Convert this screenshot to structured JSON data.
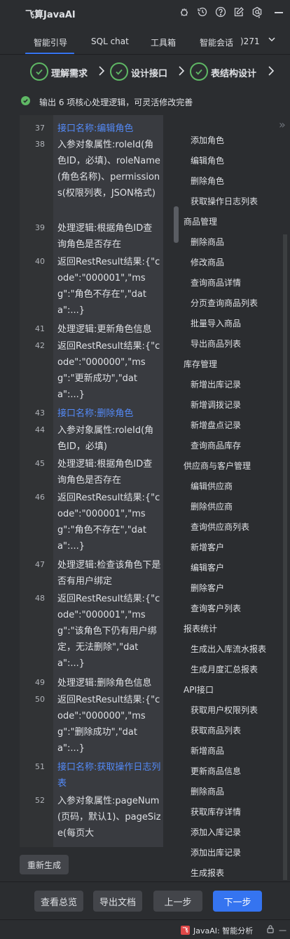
{
  "app": {
    "title": "飞算JavaAI"
  },
  "titlebar_icons": [
    "bug-icon",
    "history-icon",
    "help-icon",
    "edit-icon",
    "settings-icon"
  ],
  "tabs": [
    {
      "label": "智能引导",
      "active": true
    },
    {
      "label": "SQL chat"
    },
    {
      "label": "工具箱"
    },
    {
      "label": "智能会话"
    },
    {
      "label": ")271"
    }
  ],
  "steps": [
    {
      "label": "理解需求"
    },
    {
      "label": "设计接口"
    },
    {
      "label": "表结构设计"
    }
  ],
  "status": {
    "text": "输出 6 项核心处理逻辑，可灵活修改完善",
    "color": "#5fb865"
  },
  "editor_lines": [
    {
      "num": "37",
      "text": "接口名称:编辑角色",
      "link": true
    },
    {
      "num": "38",
      "text": "入参对象属性:roleId(角色ID，必填)、roleName(角色名称)、permissions(权限列表，JSON格式)"
    },
    {
      "num": "39",
      "text": "处理逻辑:根据角色ID查询角色是否存在"
    },
    {
      "num": "40",
      "text": "返回RestResult结果:{\"code\":\"000001\",\"msg\":\"角色不存在\",\"data\":...}"
    },
    {
      "num": "41",
      "text": "处理逻辑:更新角色信息"
    },
    {
      "num": "42",
      "text": "返回RestResult结果:{\"code\":\"000000\",\"msg\":\"更新成功\",\"data\":...}"
    },
    {
      "num": "43",
      "text": "接口名称:删除角色",
      "link": true
    },
    {
      "num": "44",
      "text": "入参对象属性:roleId(角色ID，必填)"
    },
    {
      "num": "45",
      "text": "处理逻辑:根据角色ID查询角色是否存在"
    },
    {
      "num": "46",
      "text": "返回RestResult结果:{\"code\":\"000001\",\"msg\":\"角色不存在\",\"data\":...}"
    },
    {
      "num": "47",
      "text": "处理逻辑:检查该角色下是否有用户绑定"
    },
    {
      "num": "48",
      "text": "返回RestResult结果:{\"code\":\"000001\",\"msg\":\"该角色下仍有用户绑定，无法删除\",\"data\":...}"
    },
    {
      "num": "49",
      "text": "处理逻辑:删除角色信息"
    },
    {
      "num": "50",
      "text": "返回RestResult结果:{\"code\":\"000000\",\"msg\":\"删除成功\",\"data\":...}"
    },
    {
      "num": "51",
      "text": "接口名称:获取操作日志列表",
      "link": true
    },
    {
      "num": "52",
      "text": "入参对象属性:pageNum(页码，默认1)、pageSize(每页大"
    }
  ],
  "tree": [
    {
      "label": "添加角色",
      "level": 1
    },
    {
      "label": "编辑角色",
      "level": 1
    },
    {
      "label": "删除角色",
      "level": 1
    },
    {
      "label": "获取操作日志列表",
      "level": 1
    },
    {
      "label": "商品管理",
      "level": 0
    },
    {
      "label": "删除商品",
      "level": 1
    },
    {
      "label": "修改商品",
      "level": 1
    },
    {
      "label": "查询商品详情",
      "level": 1
    },
    {
      "label": "分页查询商品列表",
      "level": 1
    },
    {
      "label": "批量导入商品",
      "level": 1
    },
    {
      "label": "导出商品列表",
      "level": 1
    },
    {
      "label": "库存管理",
      "level": 0
    },
    {
      "label": "新增出库记录",
      "level": 1
    },
    {
      "label": "新增调拨记录",
      "level": 1
    },
    {
      "label": "新增盘点记录",
      "level": 1
    },
    {
      "label": "查询商品库存",
      "level": 1
    },
    {
      "label": "供应商与客户管理",
      "level": 0
    },
    {
      "label": "编辑供应商",
      "level": 1
    },
    {
      "label": "删除供应商",
      "level": 1
    },
    {
      "label": "查询供应商列表",
      "level": 1
    },
    {
      "label": "新增客户",
      "level": 1
    },
    {
      "label": "编辑客户",
      "level": 1
    },
    {
      "label": "删除客户",
      "level": 1
    },
    {
      "label": "查询客户列表",
      "level": 1
    },
    {
      "label": "报表统计",
      "level": 0
    },
    {
      "label": "生成出入库流水报表",
      "level": 1
    },
    {
      "label": "生成月度汇总报表",
      "level": 1
    },
    {
      "label": "API接口",
      "level": 0
    },
    {
      "label": "获取用户权限列表",
      "level": 1
    },
    {
      "label": "获取商品列表",
      "level": 1
    },
    {
      "label": "新增商品",
      "level": 1
    },
    {
      "label": "更新商品信息",
      "level": 1
    },
    {
      "label": "删除商品",
      "level": 1
    },
    {
      "label": "获取库存详情",
      "level": 1
    },
    {
      "label": "添加入库记录",
      "level": 1
    },
    {
      "label": "添加出库记录",
      "level": 1
    },
    {
      "label": "生成报表",
      "level": 1
    }
  ],
  "buttons": {
    "regenerate": "重新生成",
    "overview": "查看总览",
    "export": "导出文档",
    "prev": "上一步",
    "next": "下一步"
  },
  "statusbar": {
    "text": "JavaAI: 智能分析",
    "logo": "飞",
    "cut": "一"
  },
  "colors": {
    "accent": "#3574f0",
    "success": "#5fb865",
    "link": "#548af7"
  }
}
